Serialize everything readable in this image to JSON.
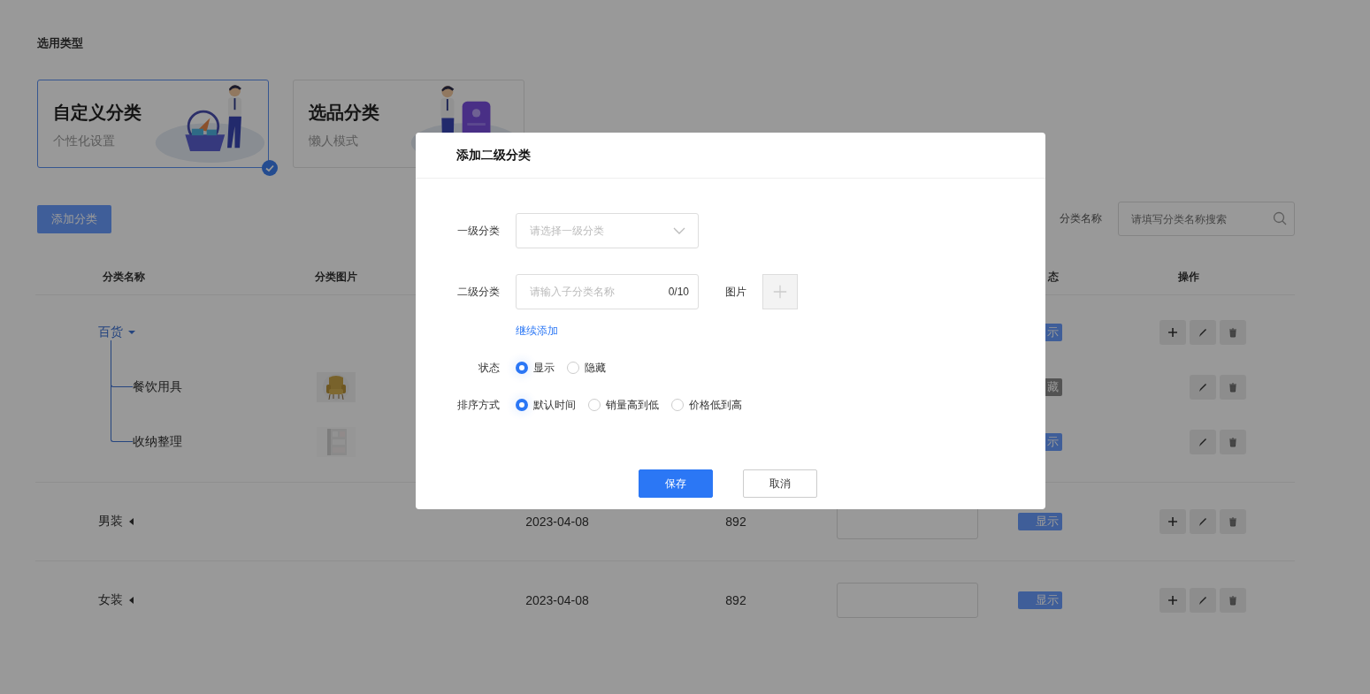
{
  "page_title": "选用类型",
  "type_cards": [
    {
      "title": "自定义分类",
      "subtitle": "个性化设置",
      "selected": true
    },
    {
      "title": "选品分类",
      "subtitle": "懒人模式",
      "selected": false
    }
  ],
  "add_button": "添加分类",
  "search": {
    "label": "分类名称",
    "placeholder": "请填写分类名称搜索"
  },
  "table": {
    "columns": [
      "分类名称",
      "分类图片",
      "态",
      "操作"
    ],
    "rows": [
      {
        "name": "百货",
        "expanded": true,
        "status": "示",
        "visible": true,
        "children": [
          {
            "name": "餐饮用具",
            "status": "藏",
            "visible": false
          },
          {
            "name": "收纳整理",
            "status": "示",
            "visible": true
          }
        ]
      },
      {
        "name": "男装",
        "expanded": false,
        "date": "2023-04-08",
        "count": "892",
        "status": "显示",
        "visible": true
      },
      {
        "name": "女装",
        "expanded": false,
        "date": "2023-04-08",
        "count": "892",
        "status": "显示",
        "visible": true
      }
    ]
  },
  "modal": {
    "title": "添加二级分类",
    "fields": [
      {
        "kind": "select",
        "label": "一级分类",
        "placeholder": "请选择一级分类"
      },
      {
        "kind": "text",
        "label": "二级分类",
        "placeholder": "请输入子分类名称",
        "counter": "0/10",
        "image_label": "图片"
      }
    ],
    "add_more_link": "继续添加",
    "radio_groups": [
      {
        "label": "状态",
        "options": [
          {
            "label": "显示",
            "selected": true
          },
          {
            "label": "隐藏",
            "selected": false
          }
        ]
      },
      {
        "label": "排序方式",
        "options": [
          {
            "label": "默认时间",
            "selected": true
          },
          {
            "label": "销量高到低",
            "selected": false
          },
          {
            "label": "价格低到高",
            "selected": false
          }
        ]
      }
    ],
    "buttons": [
      {
        "label": "保存",
        "kind": "primary"
      },
      {
        "label": "取消",
        "kind": "default"
      }
    ]
  }
}
